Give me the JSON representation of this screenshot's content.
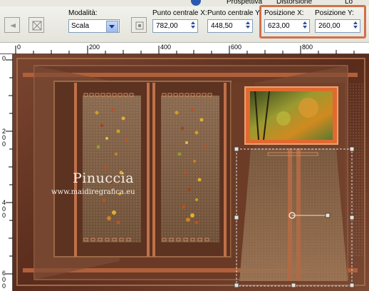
{
  "toolbar": {
    "mode_label": "Modalità:",
    "mode_value": "Scala",
    "center_x_label": "Punto centrale X:",
    "center_x_value": "782,00",
    "center_y_label": "Punto centrale Y:",
    "center_y_value": "448,50",
    "pos_x_label": "Posizione X:",
    "pos_x_value": "623,00",
    "pos_y_label": "Posizione Y:",
    "pos_y_value": "260,00",
    "top_cut_1": "Prospettiva",
    "top_cut_2": "Distorsione",
    "top_cut_3": "Lo"
  },
  "rulers": {
    "top": [
      "0",
      "200",
      "400",
      "600",
      "800"
    ],
    "left": [
      "0",
      "200",
      "400",
      "600"
    ]
  },
  "watermark": {
    "name": "Pinuccia",
    "url": "www.maidiregrafica.eu"
  },
  "colors": {
    "highlight": "#d07048",
    "canvas_brown": "#5e2f1e",
    "frame_orange": "#e07030"
  }
}
